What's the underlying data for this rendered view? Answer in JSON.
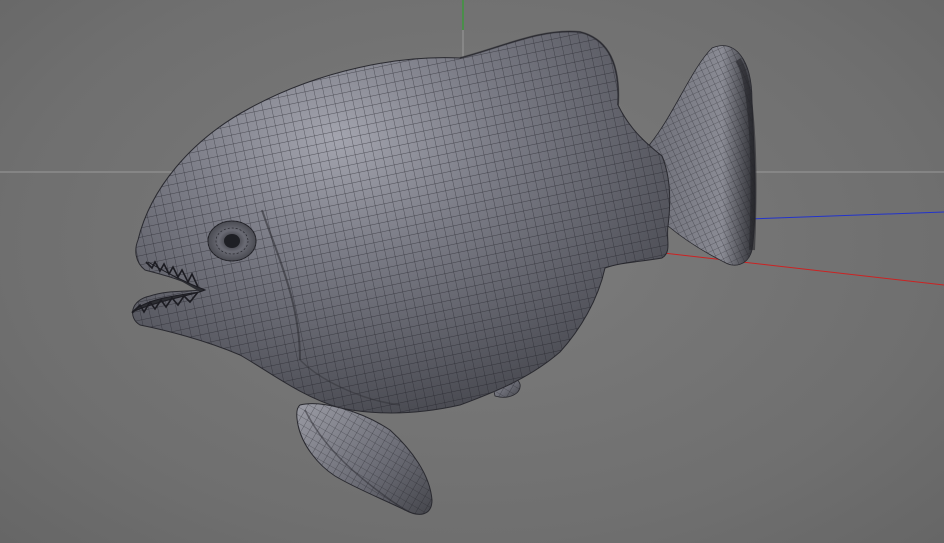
{
  "viewport": {
    "kind": "3d-perspective-viewport",
    "background_color": "#737373",
    "grid_line_color": "#9a9a9a",
    "axis_colors": {
      "x": "#cc2222",
      "y": "#22aa22",
      "z": "#2233cc"
    }
  },
  "model": {
    "subject": "piranha-fish",
    "display": "shaded-wireframe",
    "surface_color": "#5f6068",
    "highlight_color": "#9fa0aa",
    "wire_color": "#1c1c22"
  }
}
